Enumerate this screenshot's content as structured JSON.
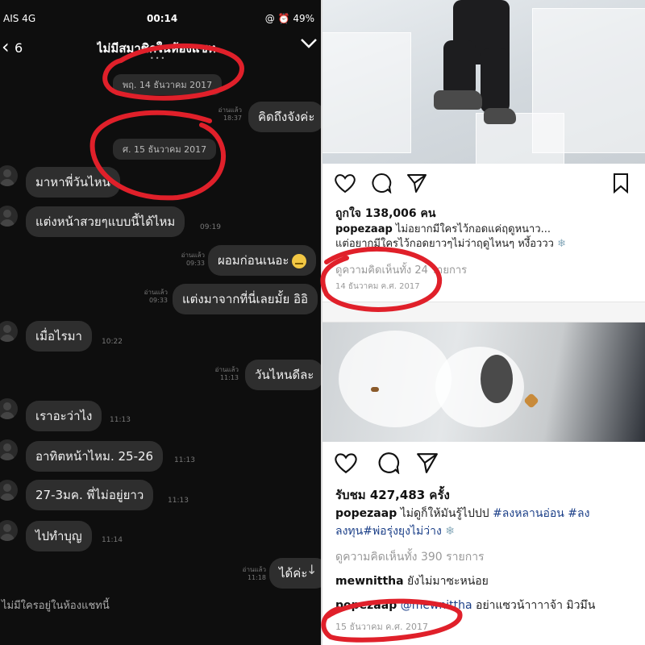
{
  "chat": {
    "status": {
      "carrier": "AIS  4G",
      "time": "00:14",
      "battery": "@ ⏰ 49%"
    },
    "header": {
      "back_count": "6",
      "title": "ไม่มีสมาชิกในห้องแชท",
      "page_dots": "•••"
    },
    "dates": [
      "พฤ. 14 ธันวาคม 2017",
      "ศ. 15 ธันวาคม 2017"
    ],
    "read_label": "อ่านแล้ว",
    "messages": [
      {
        "side": "right",
        "text": "คิดถึงจังค่ะ",
        "time": "18:37"
      },
      {
        "side": "left",
        "text": "มาหาพี่วันไหน",
        "time": ""
      },
      {
        "side": "left",
        "text": "แต่งหน้าสวยๆแบบนี้ได้ไหม",
        "time": "09:19"
      },
      {
        "side": "right",
        "text": "ผอมก่อนเนอะ",
        "time": "09:33"
      },
      {
        "side": "right",
        "text": "แต่งมาจากที่นี่เลยมั้ย อิอิ",
        "time": "09:33"
      },
      {
        "side": "left",
        "text": "เมื่อไรมา",
        "time": "10:22"
      },
      {
        "side": "right",
        "text": "วันไหนดีละ",
        "time": "11:13"
      },
      {
        "side": "left",
        "text": "เราอะว่าไง",
        "time": "11:13"
      },
      {
        "side": "left",
        "text": "อาทิตหน้าไหม. 25-26",
        "time": "11:13"
      },
      {
        "side": "left",
        "text": "27-3มค. พี่ไม่อยู่ยาว",
        "time": "11:13"
      },
      {
        "side": "left",
        "text": "ไปทำบุญ",
        "time": "11:14"
      },
      {
        "side": "right",
        "text": "ได้ค่ะ",
        "time": "11:18"
      }
    ],
    "footer": "ไม่มีใครอยู่ในห้องแชทนี้"
  },
  "instagram": {
    "post1": {
      "likes": "ถูกใจ 138,006 คน",
      "username": "popezaap",
      "caption_line1": "ไม่อยากมีใครไว้กอดแค่ฤดูหนาว...",
      "caption_line2": "แต่อยากมีใครไว้กอดยาวๆไม่ว่าฤดูไหนๆ หงึ้อววว",
      "view_comments": "ดูความคิดเห็นทั้ง 24 รายการ",
      "date": "14 ธันวาคม ค.ศ. 2017"
    },
    "post2": {
      "views": "รับชม 427,483 ครั้ง",
      "username": "popezaap",
      "caption_text": "ไม่ดูก็ให้มันรู้ไปปป",
      "hashtag1": "#ลงหลานอ่อน",
      "hashtag2": "#ลง",
      "hashtag3": "ลงทุน#พ่อรุ่งยุงไม่ว่าง",
      "view_comments": "ดูความคิดเห็นทั้ง 390 รายการ",
      "comment1_user": "mewnittha",
      "comment1_text": "ยังไม่มาซะหน่อย",
      "comment2_user": "popezaap",
      "comment2_mention": "@mewnittha",
      "comment2_text": "อย่าแซวน้าาาาจ้า มิวมึน",
      "date": "15 ธันวาคม ค.ศ. 2017"
    }
  },
  "colors": {
    "annotation_red": "#e0202a",
    "chat_bg": "#0e0e0e",
    "bubble": "#2e2e2e",
    "link_blue": "#1b3f88"
  }
}
